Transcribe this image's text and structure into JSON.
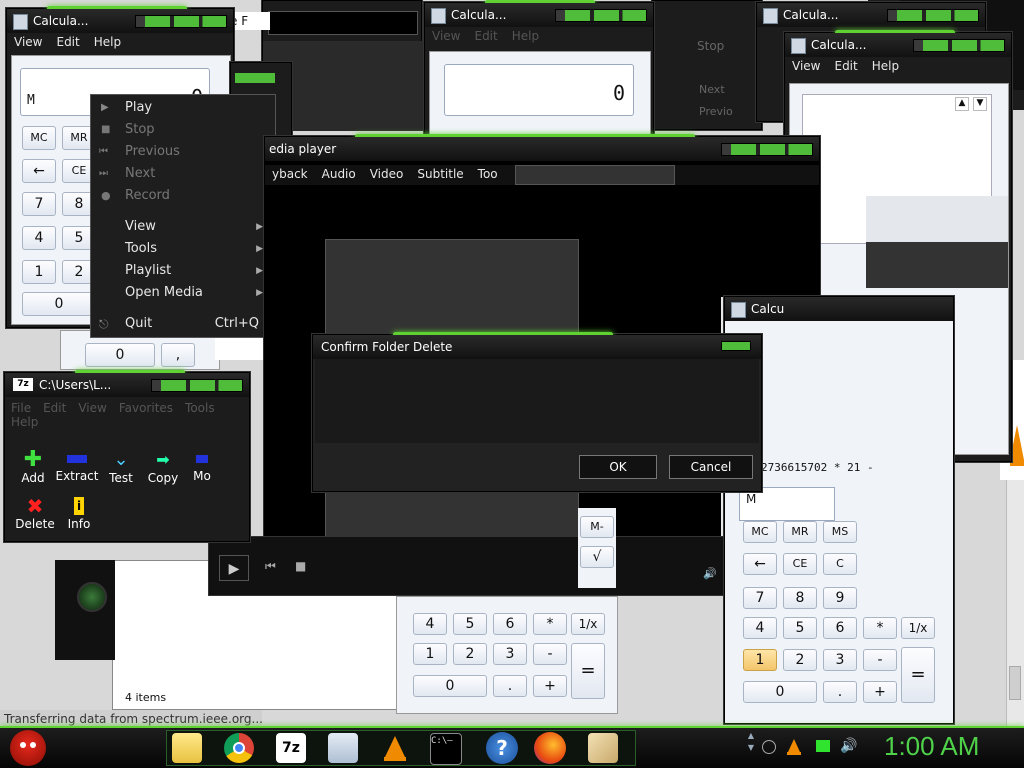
{
  "calc_main": {
    "title": "Calcula...",
    "menu": [
      "View",
      "Edit",
      "Help"
    ],
    "display_memory": "M",
    "display_value": "0",
    "keys": [
      "MC",
      "MR",
      "←",
      "CE",
      "7",
      "8",
      "4",
      "5",
      "1",
      "2",
      "0"
    ]
  },
  "calc_center": {
    "title": "Calcula...",
    "menu": [
      "View",
      "Edit",
      "Help"
    ],
    "display_value": "0",
    "keys": [
      "4",
      "5",
      "6",
      "*",
      "1/x",
      "1",
      "2",
      "3",
      "-",
      "=",
      "0",
      ".",
      "+"
    ]
  },
  "calc_right": {
    "title": "Calcula...",
    "menu": [
      "View",
      "Edit",
      "Help"
    ],
    "spin_up": "▲",
    "spin_down": "▼"
  },
  "calc_bottom_right": {
    "title": "Calcu",
    "display_memory": "M",
    "history": "2736615702 * 21 -",
    "keys": [
      "MC",
      "MR",
      "MS",
      "←",
      "CE",
      "C",
      "7",
      "8",
      "9",
      "4",
      "5",
      "6",
      "*",
      "1/x",
      "1",
      "2",
      "3",
      "-",
      "=",
      "0",
      ".",
      "+"
    ]
  },
  "far_right_title": "Calcula...",
  "overlap_title": "e F",
  "bg_toolbar": {
    "stop": "Stop",
    "next": "Next",
    "prev": "Previo"
  },
  "small_keys": {
    "zero": "0",
    "dot": ","
  },
  "context_menu": {
    "items": [
      {
        "label": "Play",
        "enabled": true
      },
      {
        "label": "Stop",
        "enabled": false
      },
      {
        "label": "Previous",
        "enabled": false
      },
      {
        "label": "Next",
        "enabled": false
      },
      {
        "label": "Record",
        "enabled": false
      }
    ],
    "submenus": [
      "View",
      "Tools",
      "Playlist",
      "Open Media"
    ],
    "quit": "Quit",
    "quit_shortcut": "Ctrl+Q"
  },
  "media_player": {
    "title": "edia player",
    "menu": [
      "yback",
      "Audio",
      "Video",
      "Subtitle",
      "Too"
    ]
  },
  "confirm_dialog": {
    "title": "Confirm Folder Delete",
    "ok": "OK",
    "cancel": "Cancel"
  },
  "sevenzip": {
    "title": "C:\\Users\\L...",
    "app_icon": "7z",
    "menu": [
      "File",
      "Edit",
      "View",
      "Favorites",
      "Tools",
      "Help"
    ],
    "tools": [
      "Add",
      "Extract",
      "Test",
      "Copy",
      "Mo",
      "Delete",
      "Info"
    ]
  },
  "explorer": {
    "items_count": "4 items"
  },
  "status_bar": {
    "text": "Transferring data from spectrum.ieee.org..."
  },
  "taskbar": {
    "clock": "1:00 AM",
    "apps": [
      "file-manager",
      "chrome",
      "7zip",
      "calculator",
      "vlc",
      "terminal",
      "help",
      "firefox",
      "image-viewer"
    ],
    "seven_zip_label": "7z",
    "terminal_label": "C:\\—",
    "help_label": "?"
  },
  "colors": {
    "accent_green": "#5fd132",
    "window_dark": "#1c1c1c",
    "clock_green": "#4fd14a"
  }
}
